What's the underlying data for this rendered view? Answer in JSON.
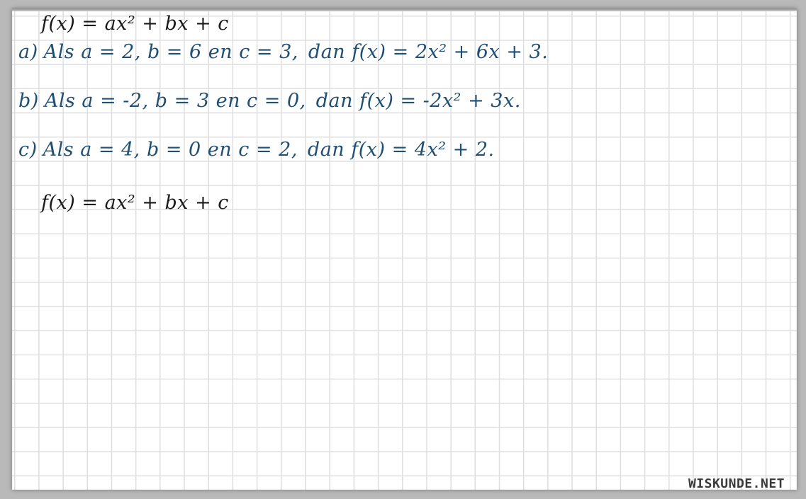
{
  "formula_top": "f(x) = ax² + bx + c",
  "items": [
    {
      "label": "a)",
      "condition": "Als a = 2, b = 6 en c = 3,",
      "result": "dan f(x) = 2x² + 6x + 3."
    },
    {
      "label": "b)",
      "condition": "Als a = -2, b = 3 en c = 0,",
      "result": "dan f(x) = -2x² + 3x."
    },
    {
      "label": "c)",
      "condition": "Als a = 4, b = 0 en c = 2,",
      "result": "dan f(x) = 4x² + 2."
    }
  ],
  "formula_bottom": "f(x) = ax² + bx + c",
  "footer": "WISKUNDE.NET",
  "colors": {
    "ink_black": "#1a1a1a",
    "ink_blue": "#1f4f73",
    "grid": "#dedede"
  }
}
